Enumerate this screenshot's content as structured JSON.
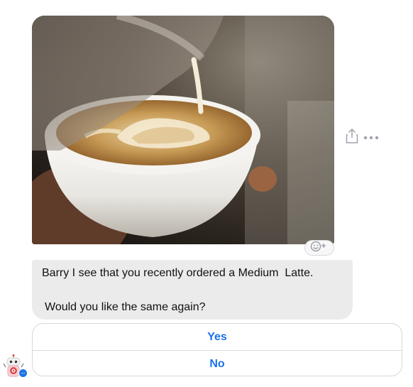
{
  "message": {
    "image_description_icon": "latte-photo",
    "text_line1": "Barry I see that you recently ordered a Medium  Latte.",
    "text_line2": "Would you like the same again?"
  },
  "quick_replies": [
    {
      "label": "Yes"
    },
    {
      "label": "No"
    }
  ],
  "icons": {
    "share": "share-icon",
    "more": "more-dots-icon",
    "react": "add-reaction-icon",
    "avatar": "robot-avatar",
    "messenger_badge": "messenger-badge-icon"
  },
  "colors": {
    "accent": "#1a73e8",
    "bubble": "#ebebeb",
    "border": "#d7d9dd"
  }
}
